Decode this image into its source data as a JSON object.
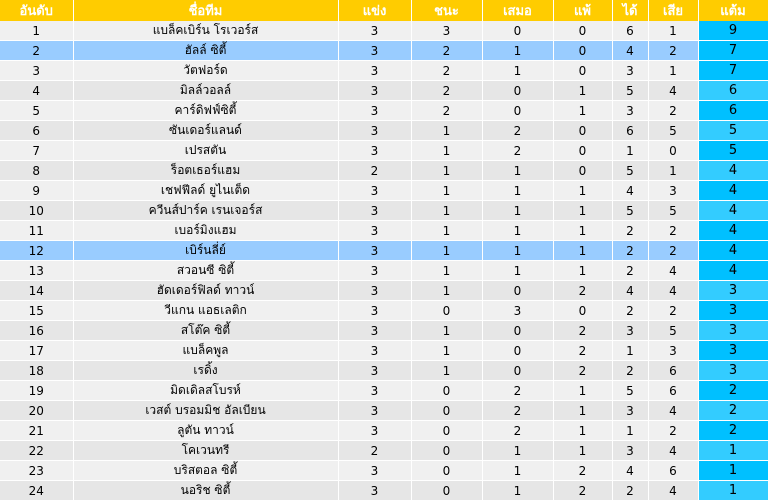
{
  "headers": [
    "อันดับ",
    "ชื่อทีม",
    "แข่ง",
    "ชนะ",
    "เสมอ",
    "แพ้",
    "ได้",
    "เสีย",
    "แต้ม"
  ],
  "colors": {
    "header": "#ffcc00",
    "points": "#00c0ff",
    "highlight": "#99ccff"
  },
  "rows": [
    {
      "rank": "1",
      "team": "แบล็คเบิร์น โรเวอร์ส",
      "p": "3",
      "w": "3",
      "d": "0",
      "l": "0",
      "gf": "6",
      "ga": "1",
      "pts": "9",
      "highlight": false
    },
    {
      "rank": "2",
      "team": "ฮัลล์ ซิตี้",
      "p": "3",
      "w": "2",
      "d": "1",
      "l": "0",
      "gf": "4",
      "ga": "2",
      "pts": "7",
      "highlight": true
    },
    {
      "rank": "3",
      "team": "วัตฟอร์ด",
      "p": "3",
      "w": "2",
      "d": "1",
      "l": "0",
      "gf": "3",
      "ga": "1",
      "pts": "7",
      "highlight": false
    },
    {
      "rank": "4",
      "team": "มิลล์วอลล์",
      "p": "3",
      "w": "2",
      "d": "0",
      "l": "1",
      "gf": "5",
      "ga": "4",
      "pts": "6",
      "highlight": false
    },
    {
      "rank": "5",
      "team": "คาร์ดิฟฟ์ซิตี้",
      "p": "3",
      "w": "2",
      "d": "0",
      "l": "1",
      "gf": "3",
      "ga": "2",
      "pts": "6",
      "highlight": false
    },
    {
      "rank": "6",
      "team": "ซันเดอร์แลนด์",
      "p": "3",
      "w": "1",
      "d": "2",
      "l": "0",
      "gf": "6",
      "ga": "5",
      "pts": "5",
      "highlight": false
    },
    {
      "rank": "7",
      "team": "เปรสตัน",
      "p": "3",
      "w": "1",
      "d": "2",
      "l": "0",
      "gf": "1",
      "ga": "0",
      "pts": "5",
      "highlight": false
    },
    {
      "rank": "8",
      "team": "ร็อตเธอร์แฮม",
      "p": "2",
      "w": "1",
      "d": "1",
      "l": "0",
      "gf": "5",
      "ga": "1",
      "pts": "4",
      "highlight": false
    },
    {
      "rank": "9",
      "team": "เชฟฟีลด์ ยูไนเต็ด",
      "p": "3",
      "w": "1",
      "d": "1",
      "l": "1",
      "gf": "4",
      "ga": "3",
      "pts": "4",
      "highlight": false
    },
    {
      "rank": "10",
      "team": "ควีนส์ปาร์ค เรนเจอร์ส",
      "p": "3",
      "w": "1",
      "d": "1",
      "l": "1",
      "gf": "5",
      "ga": "5",
      "pts": "4",
      "highlight": false
    },
    {
      "rank": "11",
      "team": "เบอร์มิงแฮม",
      "p": "3",
      "w": "1",
      "d": "1",
      "l": "1",
      "gf": "2",
      "ga": "2",
      "pts": "4",
      "highlight": false
    },
    {
      "rank": "12",
      "team": "เบิร์นลี่ย์",
      "p": "3",
      "w": "1",
      "d": "1",
      "l": "1",
      "gf": "2",
      "ga": "2",
      "pts": "4",
      "highlight": true
    },
    {
      "rank": "13",
      "team": "สวอนซี ซิตี้",
      "p": "3",
      "w": "1",
      "d": "1",
      "l": "1",
      "gf": "2",
      "ga": "4",
      "pts": "4",
      "highlight": false
    },
    {
      "rank": "14",
      "team": "ฮัดเดอร์ฟิลด์ ทาวน์",
      "p": "3",
      "w": "1",
      "d": "0",
      "l": "2",
      "gf": "4",
      "ga": "4",
      "pts": "3",
      "highlight": false
    },
    {
      "rank": "15",
      "team": "วีแกน แอธเลติก",
      "p": "3",
      "w": "0",
      "d": "3",
      "l": "0",
      "gf": "2",
      "ga": "2",
      "pts": "3",
      "highlight": false
    },
    {
      "rank": "16",
      "team": "สโต๊ค ซิตี้",
      "p": "3",
      "w": "1",
      "d": "0",
      "l": "2",
      "gf": "3",
      "ga": "5",
      "pts": "3",
      "highlight": false
    },
    {
      "rank": "17",
      "team": "แบล็คพูล",
      "p": "3",
      "w": "1",
      "d": "0",
      "l": "2",
      "gf": "1",
      "ga": "3",
      "pts": "3",
      "highlight": false
    },
    {
      "rank": "18",
      "team": "เรดิ้ง",
      "p": "3",
      "w": "1",
      "d": "0",
      "l": "2",
      "gf": "2",
      "ga": "6",
      "pts": "3",
      "highlight": false
    },
    {
      "rank": "19",
      "team": "มิดเดิลสโบรห์",
      "p": "3",
      "w": "0",
      "d": "2",
      "l": "1",
      "gf": "5",
      "ga": "6",
      "pts": "2",
      "highlight": false
    },
    {
      "rank": "20",
      "team": "เวสต์ บรอมมิช อัลเบียน",
      "p": "3",
      "w": "0",
      "d": "2",
      "l": "1",
      "gf": "3",
      "ga": "4",
      "pts": "2",
      "highlight": false
    },
    {
      "rank": "21",
      "team": "ลูตัน ทาวน์",
      "p": "3",
      "w": "0",
      "d": "2",
      "l": "1",
      "gf": "1",
      "ga": "2",
      "pts": "2",
      "highlight": false
    },
    {
      "rank": "22",
      "team": "โคเวนทรี",
      "p": "2",
      "w": "0",
      "d": "1",
      "l": "1",
      "gf": "3",
      "ga": "4",
      "pts": "1",
      "highlight": false
    },
    {
      "rank": "23",
      "team": "บริสตอล ซิตี้",
      "p": "3",
      "w": "0",
      "d": "1",
      "l": "2",
      "gf": "4",
      "ga": "6",
      "pts": "1",
      "highlight": false
    },
    {
      "rank": "24",
      "team": "นอริช ซิตี้",
      "p": "3",
      "w": "0",
      "d": "1",
      "l": "2",
      "gf": "2",
      "ga": "4",
      "pts": "1",
      "highlight": false
    }
  ]
}
